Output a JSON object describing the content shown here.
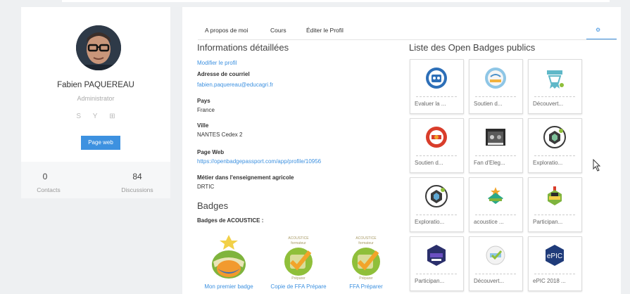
{
  "profile": {
    "name": "Fabien PAQUEREAU",
    "role": "Administrator",
    "social_icons": [
      "skype-icon",
      "yahoo-icon",
      "windows-icon"
    ],
    "social_glyphs": [
      "S",
      "Y",
      "⊞"
    ],
    "page_button": "Page web",
    "stats": [
      {
        "value": "0",
        "label": "Contacts"
      },
      {
        "value": "84",
        "label": "Discussions"
      }
    ]
  },
  "tabs": [
    "A propos de moi",
    "Cours",
    "Éditer le Profil"
  ],
  "details": {
    "title": "Informations détaillées",
    "edit_link": "Modifier le profil",
    "email_label": "Adresse de courriel",
    "email": "fabien.paquereau@educagri.fr",
    "country_label": "Pays",
    "country": "France",
    "city_label": "Ville",
    "city": "NANTES Cedex 2",
    "web_label": "Page Web",
    "web": "https://openbadgepassport.com/app/profile/10956",
    "job_label": "Métier dans l'enseignement agricole",
    "job": "DRTIC"
  },
  "badges": {
    "title": "Badges",
    "subtitle": "Badges de ACOUSTICE :",
    "items": [
      {
        "label": "Mon premier badge"
      },
      {
        "label": "Copie de FFA Prépare"
      },
      {
        "label": "FFA Préparer"
      }
    ]
  },
  "open_badges": {
    "title": "Liste des Open Badges publics",
    "items": [
      {
        "label": "Evaluer la ..."
      },
      {
        "label": "Soutien d..."
      },
      {
        "label": "Découvert..."
      },
      {
        "label": "Soutien d..."
      },
      {
        "label": "Fan d'Eleg..."
      },
      {
        "label": "Exploratio..."
      },
      {
        "label": "Exploratio..."
      },
      {
        "label": "acoustice ..."
      },
      {
        "label": "Participan..."
      },
      {
        "label": "Participan..."
      },
      {
        "label": "Découvert..."
      },
      {
        "label": "ePIC 2018 ..."
      }
    ]
  },
  "colors": {
    "accent": "#3d91e0",
    "page_bg": "#eef0f2"
  }
}
